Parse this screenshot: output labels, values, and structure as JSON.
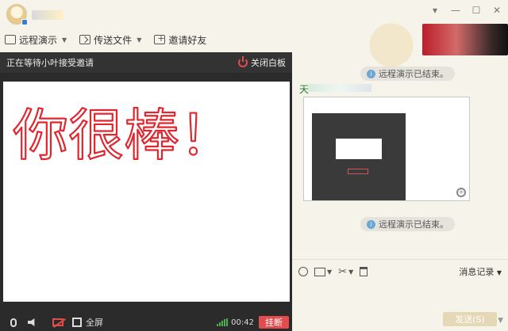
{
  "window": {
    "controls": [
      "▾",
      "—",
      "☐",
      "✕"
    ]
  },
  "toolbar": {
    "remote_demo": "远程演示",
    "send_file": "传送文件",
    "invite": "邀请好友"
  },
  "whiteboard": {
    "status": "正在等待小叶接受邀请",
    "close_label": "关闭白板",
    "handwriting": "你很棒！",
    "stroke_color": "#e0262f"
  },
  "call_bar": {
    "fullscreen_label": "全屏",
    "timer": "00:42",
    "hangup_label": "挂断"
  },
  "chat": {
    "notice1": "远程演示已结束。",
    "sender_initial": "天",
    "notice2": "远程演示已结束。",
    "history_label": "消息记录",
    "send_label": "发送(S)"
  },
  "colors": {
    "accent_red": "#e14d4d",
    "chat_bg": "#f6f3ea",
    "sender_green": "#1a7d2a"
  }
}
